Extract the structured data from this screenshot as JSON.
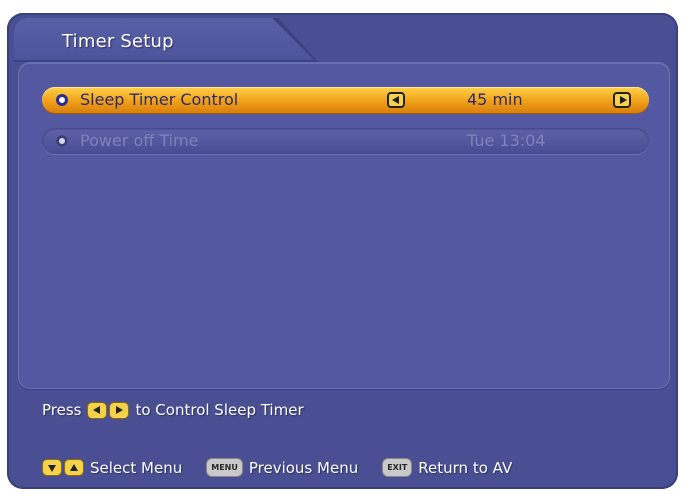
{
  "window": {
    "title": "Timer Setup"
  },
  "rows": [
    {
      "label": "Sleep Timer Control",
      "value": "45 min",
      "state": "selected"
    },
    {
      "label": "Power off Time",
      "value": "Tue 13:04",
      "state": "disabled"
    }
  ],
  "hint": {
    "prefix": "Press",
    "suffix": "to Control Sleep Timer"
  },
  "footer": {
    "select_label": "Select Menu",
    "menu_key": "MENU",
    "previous_label": "Previous Menu",
    "exit_key": "EXIT",
    "return_label": "Return to AV"
  },
  "colors": {
    "background": "#4a4f94",
    "highlight": "#f0a018",
    "key_yellow": "#f4d34a"
  }
}
